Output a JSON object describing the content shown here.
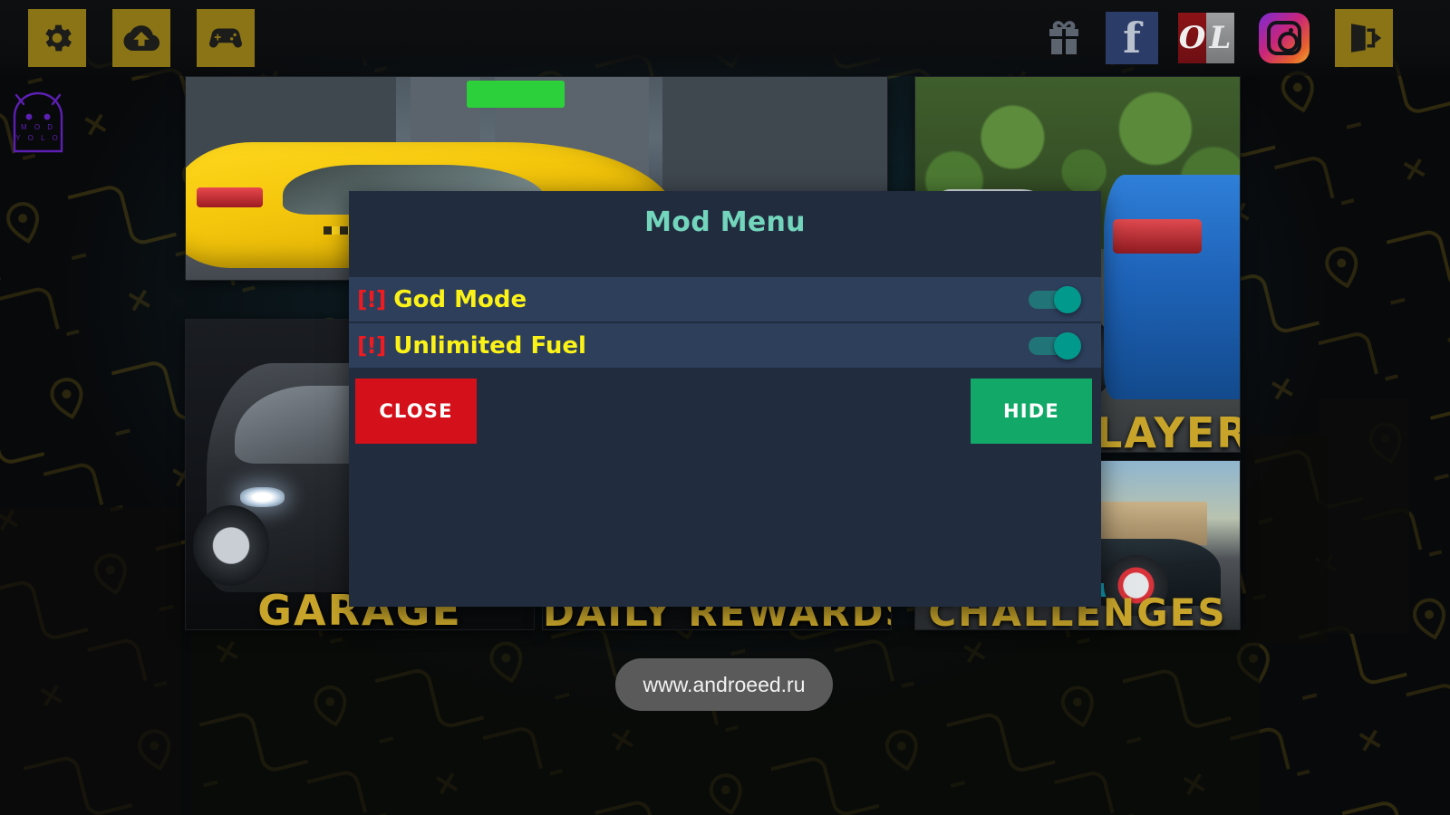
{
  "toolbar": {
    "left_items": [
      {
        "name": "settings",
        "icon": "gear-icon",
        "bg": "#8a7416"
      },
      {
        "name": "cloud-save",
        "icon": "cloud-upload-icon",
        "bg": "#8a7416"
      },
      {
        "name": "games",
        "icon": "gamepad-icon",
        "bg": "#8a7416"
      }
    ],
    "right_items": [
      {
        "name": "gift",
        "icon": "gift-icon"
      },
      {
        "name": "facebook",
        "icon": "facebook-icon",
        "glyph": "f"
      },
      {
        "name": "ol-logo",
        "icon": "ol-logo-icon",
        "glyph_left": "O",
        "glyph_right": "L"
      },
      {
        "name": "instagram",
        "icon": "instagram-icon"
      },
      {
        "name": "exit",
        "icon": "exit-door-icon",
        "bg": "#8a7416"
      }
    ]
  },
  "logo": {
    "name": "modyolo-logo",
    "line1": "M O D",
    "line2": "Y O L O",
    "color": "#5c1fb3"
  },
  "background": {
    "tiles": [
      {
        "id": "taxi",
        "label": ""
      },
      {
        "id": "multiplayer",
        "label": "MULTIPLAYER"
      },
      {
        "id": "garage",
        "label": "GARAGE"
      },
      {
        "id": "rewards",
        "label": "DAILY REWARDS"
      },
      {
        "id": "challenges",
        "label": "CHALLENGES"
      }
    ],
    "label_color": "#c8a52a"
  },
  "dialog": {
    "title": "Mod Menu",
    "title_color": "#72d5bc",
    "body_color": "#212c3e",
    "row_color": "#2e3f5c",
    "rows": [
      {
        "warn": "[!]",
        "label": "God Mode",
        "enabled": true
      },
      {
        "warn": "[!]",
        "label": "Unlimited Fuel",
        "enabled": true
      }
    ],
    "buttons": {
      "close": {
        "label": "CLOSE",
        "color": "#d4101a"
      },
      "hide": {
        "label": "HIDE",
        "color": "#12a868"
      }
    },
    "label_color": "#fbf218",
    "warn_color": "#ef1b20",
    "switch_on_color": "#01998c"
  },
  "watermark": {
    "text": "www.androeed.ru"
  }
}
